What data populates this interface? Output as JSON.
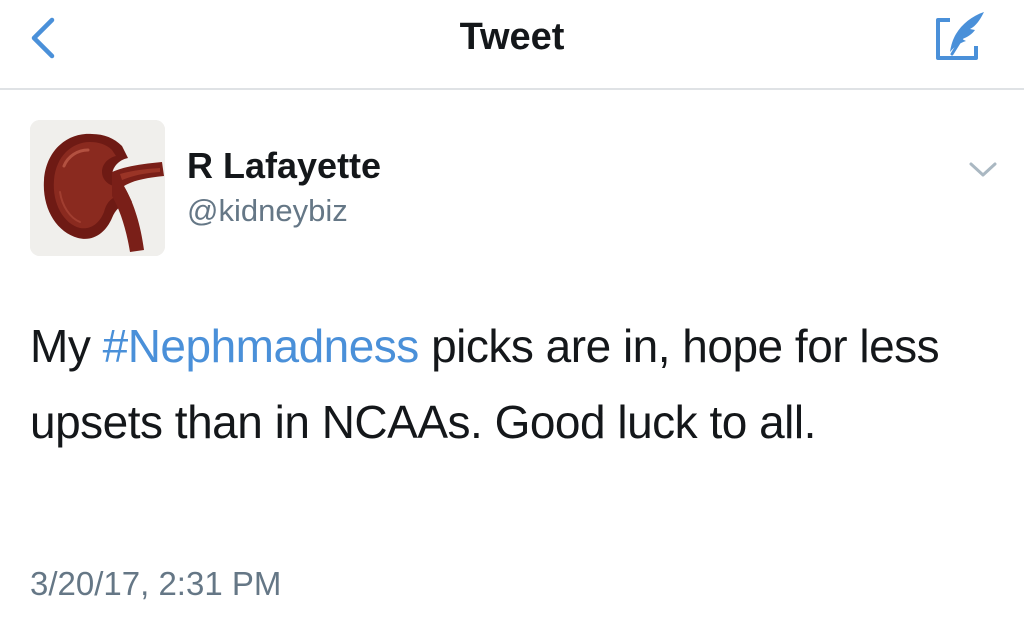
{
  "nav": {
    "title": "Tweet",
    "back_icon": "chevron-left-icon",
    "compose_icon": "compose-quill-icon",
    "accent_color": "#4a90d9"
  },
  "tweet": {
    "author": {
      "display_name": "R Lafayette",
      "handle": "@kidneybiz",
      "avatar": "kidney-photo"
    },
    "menu_icon": "chevron-down-icon",
    "text": {
      "before": "My ",
      "hashtag": "#Nephmadness",
      "after": " picks are in, hope for less upsets than in NCAAs.  Good luck to all."
    },
    "timestamp": "3/20/17, 2:31 PM"
  }
}
